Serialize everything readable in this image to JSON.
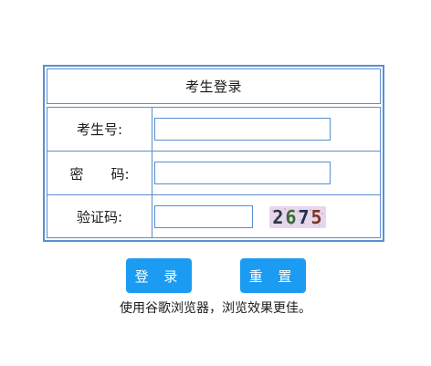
{
  "login_box": {
    "title": "考生登录",
    "fields": [
      {
        "label": "考生号:",
        "value": "",
        "placeholder": ""
      },
      {
        "label": "密　　码:",
        "value": "",
        "placeholder": ""
      },
      {
        "label": "验证码:",
        "value": "",
        "placeholder": ""
      }
    ],
    "captcha": {
      "text": "2675",
      "digits": [
        "2",
        "6",
        "7",
        "5"
      ]
    }
  },
  "buttons": {
    "login_label": "登 录",
    "reset_label": "重 置"
  },
  "hint": "使用谷歌浏览器，浏览效果更佳。",
  "colors": {
    "border": "#5b8fcf",
    "button_bg": "#1b9cf2",
    "button_text": "#ffffff",
    "captcha_bg": "#e7d6ec"
  }
}
